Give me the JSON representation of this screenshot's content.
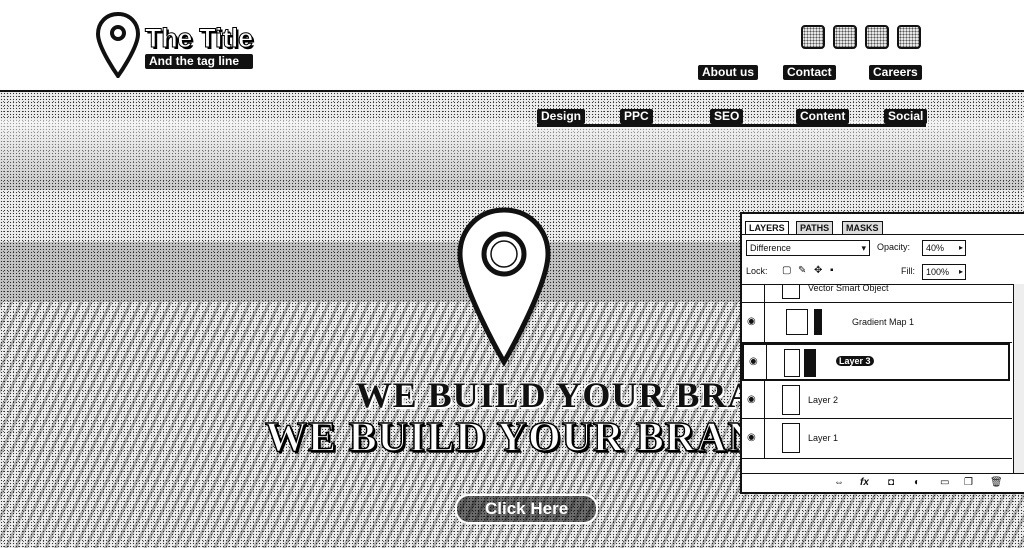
{
  "header": {
    "title": "The Title",
    "tagline": "And the tag line",
    "links": [
      {
        "label": "About us"
      },
      {
        "label": "Contact"
      },
      {
        "label": "Careers"
      }
    ],
    "social_icons": [
      "social-icon-1",
      "social-icon-2",
      "social-icon-3",
      "social-icon-4"
    ]
  },
  "hero": {
    "nav": [
      {
        "label": "Design"
      },
      {
        "label": "PPC"
      },
      {
        "label": "SEO"
      },
      {
        "label": "Content"
      },
      {
        "label": "Social"
      }
    ],
    "headline_shadow": "WE BUILD YOUR BRAND",
    "headline": "WE BUILD YOUR BRAN",
    "cta_label": "Click Here"
  },
  "layers_panel": {
    "tabs": [
      "LAYERS",
      "PATHS",
      "MASKS"
    ],
    "blend_mode": "Difference",
    "opacity_label": "Opacity:",
    "opacity_value": "40%",
    "lock_label": "Lock:",
    "fill_label": "Fill:",
    "fill_value": "100%",
    "layers": [
      {
        "name": "Vector Smart Object",
        "selected": false
      },
      {
        "name": "Gradient Map 1",
        "selected": false
      },
      {
        "name": "Layer 3",
        "selected": true
      },
      {
        "name": "Layer 2",
        "selected": false
      },
      {
        "name": "Layer 1",
        "selected": false
      }
    ],
    "bottom_icons": [
      "link-icon",
      "fx-icon",
      "mask-icon",
      "adjustment-icon",
      "folder-icon",
      "new-layer-icon",
      "trash-icon"
    ]
  }
}
